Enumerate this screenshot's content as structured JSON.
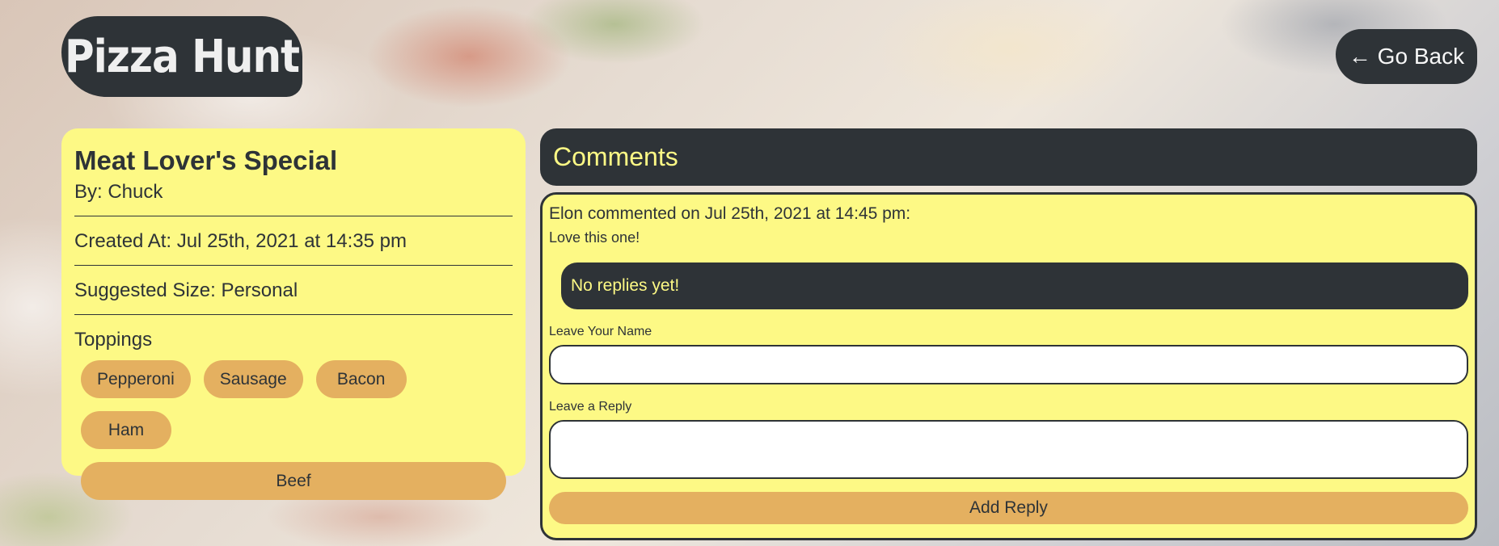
{
  "header": {
    "logo_text": "Pizza Hunt",
    "go_back_label": "← Go Back"
  },
  "pizza": {
    "name": "Meat Lover's Special",
    "author": "By: Chuck",
    "created_at": "Created At: Jul 25th, 2021 at 14:35 pm",
    "size": "Suggested Size: Personal",
    "toppings_title": "Toppings",
    "toppings": [
      "Pepperoni",
      "Sausage",
      "Bacon",
      "Ham",
      "Beef"
    ]
  },
  "comments": {
    "title": "Comments",
    "items": [
      {
        "heading": "Elon commented on Jul 25th, 2021 at 14:45 pm:",
        "body": "Love this one!",
        "replies_text": "No replies yet!",
        "name_label": "Leave Your Name",
        "name_value": "",
        "reply_label": "Leave a Reply",
        "reply_value": "",
        "submit_label": "Add Reply"
      }
    ]
  },
  "colors": {
    "dark": "#2e3337",
    "card_yellow": "#fdf985",
    "pill_orange": "#e4b060"
  }
}
